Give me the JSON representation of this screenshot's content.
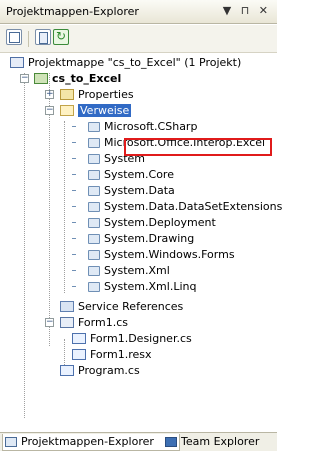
{
  "panel": {
    "title": "Projektmappen-Explorer",
    "controls": "▼ ⊓ ✕"
  },
  "tree": {
    "solution": "Projektmappe \"cs_to_Excel\" (1 Projekt)",
    "project": "cs_to_Excel",
    "properties": "Properties",
    "references_folder": "Verweise",
    "references": [
      "Microsoft.CSharp",
      "Microsoft.Office.Interop.Excel",
      "System",
      "System.Core",
      "System.Data",
      "System.Data.DataSetExtensions",
      "System.Deployment",
      "System.Drawing",
      "System.Windows.Forms",
      "System.Xml",
      "System.Xml.Linq"
    ],
    "service_references": "Service References",
    "form": "Form1.cs",
    "form_children": [
      "Form1.Designer.cs",
      "Form1.resx"
    ],
    "program": "Program.cs"
  },
  "tabs": [
    "Projektmappen-Explorer",
    "Team Explorer"
  ],
  "colors": {
    "selection": "#316ac5",
    "highlight_box": "#e01b1b"
  }
}
